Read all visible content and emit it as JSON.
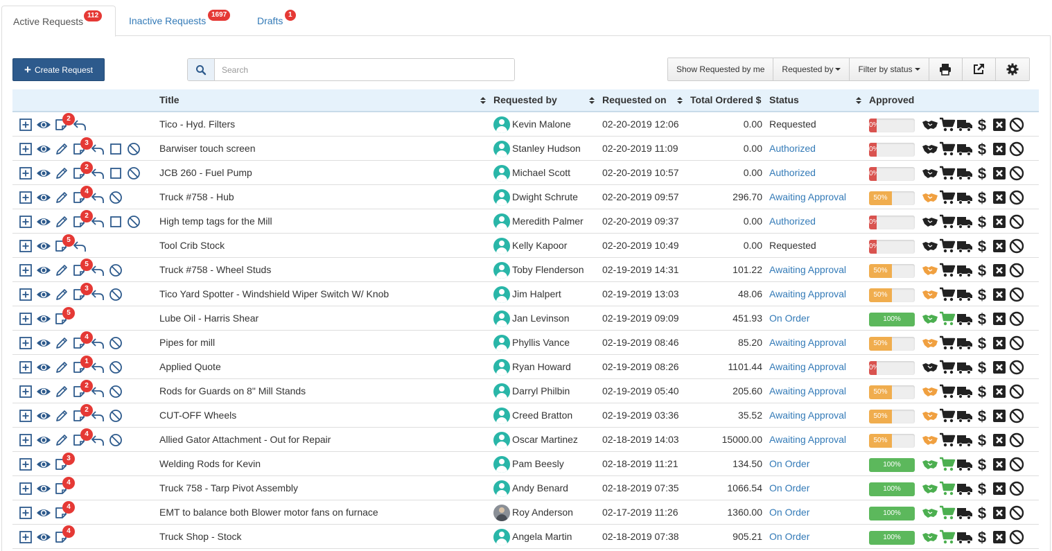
{
  "tabs": [
    {
      "label": "Active Requests",
      "count": "112"
    },
    {
      "label": "Inactive Requests",
      "count": "1697"
    },
    {
      "label": "Drafts",
      "count": "1"
    }
  ],
  "toolbar": {
    "create_label": "Create Request",
    "search_placeholder": "Search",
    "show_mine_label": "Show Requested by me",
    "requested_by_label": "Requested by",
    "filter_status_label": "Filter by status"
  },
  "columns": {
    "title": "Title",
    "requested_by": "Requested by",
    "requested_on": "Requested on",
    "total": "Total Ordered $",
    "status": "Status",
    "approved": "Approved"
  },
  "colors": {
    "danger": "#d9534f",
    "warning": "#f0ad4e",
    "success": "#5cb85c",
    "link": "#337ab7",
    "icon_dark": "#222222",
    "orange_icon": "#f0a040",
    "green_icon": "#4caf50"
  },
  "rows": [
    {
      "actions": [
        "plus",
        "eye",
        "note",
        "undo"
      ],
      "notes": "2",
      "title": "Tico - Hyd. Filters",
      "user": "Kevin Malone",
      "date": "02-20-2019 12:06",
      "total": "0.00",
      "status": "Requested",
      "status_link": false,
      "pct": 0,
      "pct_label": "0%",
      "handshake": "dark",
      "cart": "dark"
    },
    {
      "actions": [
        "plus",
        "eye",
        "pencil",
        "note",
        "undo",
        "square",
        "ban"
      ],
      "notes": "3",
      "title": "Barwiser touch screen",
      "user": "Stanley Hudson",
      "date": "02-20-2019 11:09",
      "total": "0.00",
      "status": "Authorized",
      "status_link": true,
      "pct": 0,
      "pct_label": "0%",
      "handshake": "dark",
      "cart": "dark"
    },
    {
      "actions": [
        "plus",
        "eye",
        "pencil",
        "note",
        "undo",
        "square",
        "ban"
      ],
      "notes": "2",
      "title": "JCB 260 - Fuel Pump",
      "user": "Michael Scott",
      "date": "02-20-2019 10:57",
      "total": "0.00",
      "status": "Authorized",
      "status_link": true,
      "pct": 0,
      "pct_label": "0%",
      "handshake": "dark",
      "cart": "dark"
    },
    {
      "actions": [
        "plus",
        "eye",
        "pencil",
        "note",
        "undo",
        "ban"
      ],
      "notes": "4",
      "title": "Truck #758 - Hub",
      "user": "Dwight Schrute",
      "date": "02-20-2019 09:57",
      "total": "296.70",
      "status": "Awaiting Approval",
      "status_link": true,
      "pct": 50,
      "pct_label": "50%",
      "handshake": "orange",
      "cart": "dark"
    },
    {
      "actions": [
        "plus",
        "eye",
        "pencil",
        "note",
        "undo",
        "square",
        "ban"
      ],
      "notes": "2",
      "title": "High temp tags for the Mill",
      "user": "Meredith Palmer",
      "date": "02-20-2019 09:37",
      "total": "0.00",
      "status": "Authorized",
      "status_link": true,
      "pct": 0,
      "pct_label": "0%",
      "handshake": "dark",
      "cart": "dark"
    },
    {
      "actions": [
        "plus",
        "eye",
        "note",
        "undo"
      ],
      "notes": "5",
      "title": "Tool Crib Stock",
      "user": "Kelly Kapoor",
      "date": "02-20-2019 10:49",
      "total": "0.00",
      "status": "Requested",
      "status_link": false,
      "pct": 0,
      "pct_label": "0%",
      "handshake": "dark",
      "cart": "dark"
    },
    {
      "actions": [
        "plus",
        "eye",
        "pencil",
        "note",
        "undo",
        "ban"
      ],
      "notes": "5",
      "title": "Truck #758 - Wheel Studs",
      "user": "Toby Flenderson",
      "date": "02-19-2019 14:31",
      "total": "101.22",
      "status": "Awaiting Approval",
      "status_link": true,
      "pct": 50,
      "pct_label": "50%",
      "handshake": "orange",
      "cart": "dark"
    },
    {
      "actions": [
        "plus",
        "eye",
        "pencil",
        "note",
        "undo",
        "ban"
      ],
      "notes": "3",
      "title": "Tico Yard Spotter - Windshield Wiper Switch W/ Knob",
      "user": "Jim Halpert",
      "date": "02-19-2019 13:03",
      "total": "48.06",
      "status": "Awaiting Approval",
      "status_link": true,
      "pct": 50,
      "pct_label": "50%",
      "handshake": "orange",
      "cart": "dark"
    },
    {
      "actions": [
        "plus",
        "eye",
        "note"
      ],
      "notes": "5",
      "title": "Lube Oil - Harris Shear",
      "user": "Jan Levinson",
      "date": "02-19-2019 09:09",
      "total": "451.93",
      "status": "On Order",
      "status_link": true,
      "pct": 100,
      "pct_label": "100%",
      "handshake": "green",
      "cart": "green"
    },
    {
      "actions": [
        "plus",
        "eye",
        "pencil",
        "note",
        "undo",
        "ban"
      ],
      "notes": "4",
      "title": "Pipes for mill",
      "user": "Phyllis Vance",
      "date": "02-19-2019 08:46",
      "total": "85.20",
      "status": "Awaiting Approval",
      "status_link": true,
      "pct": 50,
      "pct_label": "50%",
      "handshake": "orange",
      "cart": "dark"
    },
    {
      "actions": [
        "plus",
        "eye",
        "pencil",
        "note",
        "undo",
        "ban"
      ],
      "notes": "1",
      "title": "Applied Quote",
      "user": "Ryan Howard",
      "date": "02-19-2019 08:26",
      "total": "1101.44",
      "status": "Awaiting Approval",
      "status_link": true,
      "pct": 0,
      "pct_label": "0%",
      "handshake": "dark",
      "cart": "dark"
    },
    {
      "actions": [
        "plus",
        "eye",
        "pencil",
        "note",
        "undo",
        "ban"
      ],
      "notes": "2",
      "title": "Rods for Guards on 8\" Mill Stands",
      "user": "Darryl Philbin",
      "date": "02-19-2019 05:40",
      "total": "205.60",
      "status": "Awaiting Approval",
      "status_link": true,
      "pct": 50,
      "pct_label": "50%",
      "handshake": "orange",
      "cart": "dark"
    },
    {
      "actions": [
        "plus",
        "eye",
        "pencil",
        "note",
        "undo",
        "ban"
      ],
      "notes": "2",
      "title": "CUT-OFF Wheels",
      "user": "Creed Bratton",
      "date": "02-19-2019 03:36",
      "total": "35.52",
      "status": "Awaiting Approval",
      "status_link": true,
      "pct": 50,
      "pct_label": "50%",
      "handshake": "orange",
      "cart": "dark"
    },
    {
      "actions": [
        "plus",
        "eye",
        "pencil",
        "note",
        "undo",
        "ban"
      ],
      "notes": "4",
      "title": "Allied Gator Attachment - Out for Repair",
      "user": "Oscar Martinez",
      "date": "02-18-2019 14:03",
      "total": "15000.00",
      "status": "Awaiting Approval",
      "status_link": true,
      "pct": 50,
      "pct_label": "50%",
      "handshake": "orange",
      "cart": "dark"
    },
    {
      "actions": [
        "plus",
        "eye",
        "note"
      ],
      "notes": "3",
      "title": "Welding Rods for Kevin",
      "user": " Pam Beesly",
      "date": "02-18-2019 11:21",
      "total": "134.50",
      "status": "On Order",
      "status_link": true,
      "pct": 100,
      "pct_label": "100%",
      "handshake": "green",
      "cart": "green"
    },
    {
      "actions": [
        "plus",
        "eye",
        "note"
      ],
      "notes": "4",
      "title": "Truck 758 - Tarp Pivot Assembly",
      "user": "Andy Benard",
      "date": "02-18-2019 07:35",
      "total": "1066.54",
      "status": "On Order",
      "status_link": true,
      "pct": 100,
      "pct_label": "100%",
      "handshake": "green",
      "cart": "green"
    },
    {
      "actions": [
        "plus",
        "eye",
        "note"
      ],
      "notes": "4",
      "title": "EMT to balance both Blower motor fans on furnace",
      "user": "Roy Anderson",
      "date": "02-17-2019 11:26",
      "total": "1360.00",
      "status": "On Order",
      "status_link": true,
      "pct": 100,
      "pct_label": "100%",
      "handshake": "green",
      "cart": "green",
      "photo": true
    },
    {
      "actions": [
        "plus",
        "eye",
        "note"
      ],
      "notes": "4",
      "title": "Truck Shop - Stock",
      "user": "Angela Martin",
      "date": "02-18-2019 07:38",
      "total": "905.21",
      "status": "On Order",
      "status_link": true,
      "pct": 100,
      "pct_label": "100%",
      "handshake": "green",
      "cart": "green"
    }
  ]
}
